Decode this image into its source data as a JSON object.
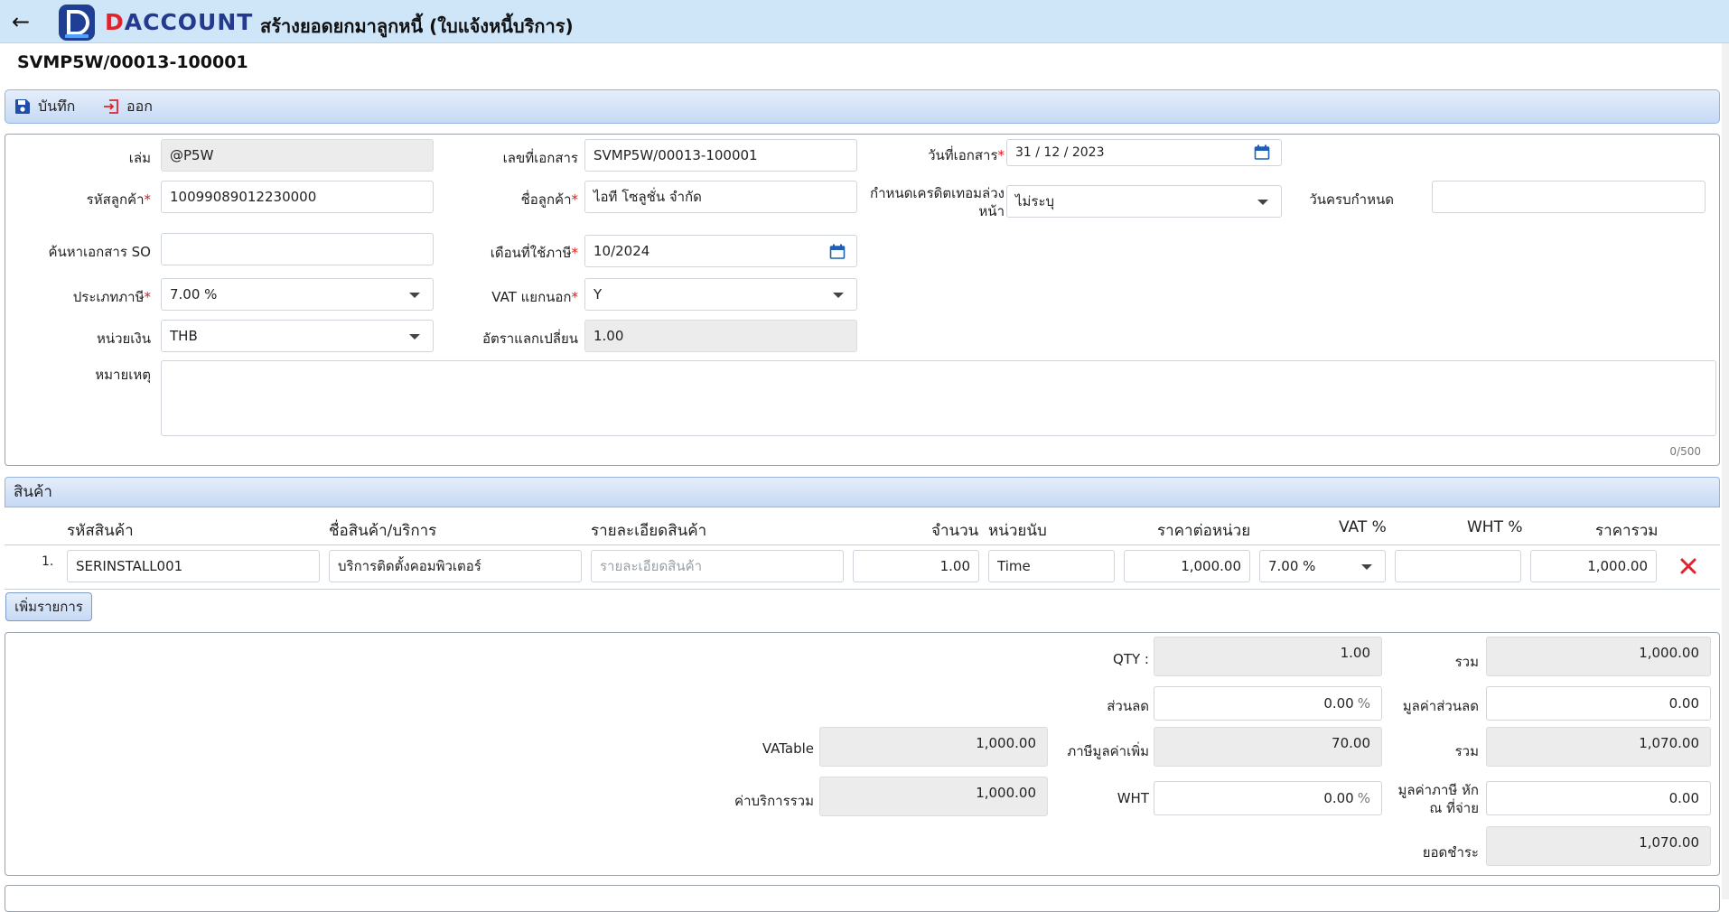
{
  "header": {
    "brand": "DACCOUNT",
    "brand_first": "D",
    "brand_rest": "ACCOUNT",
    "title": "สร้างยอดยกมาลูกหนี้ (ใบแจ้งหนี้บริการ)",
    "doc_number": "SVMP5W/00013-100001"
  },
  "toolbar": {
    "save_label": "บันทึก",
    "exit_label": "ออก"
  },
  "form": {
    "book_label": "เล่ม",
    "book_value": "@P5W",
    "docno_label": "เลขที่เอกสาร",
    "docno_value": "SVMP5W/00013-100001",
    "docdate_label": "วันที่เอกสาร",
    "docdate_value": "31 / 12 /  2023",
    "custcode_label": "รหัสลูกค้า",
    "custcode_value": "10099089012230000",
    "custname_label": "ชื่อลูกค้า",
    "custname_value": "ไอที โซลูชั่น จำกัด",
    "credit_label_1": "กำหนดเครดิตเทอมล่วง",
    "credit_label_2": "หน้า",
    "credit_value": "ไม่ระบุ",
    "duedate_label": "วันครบกำหนด",
    "duedate_value": "",
    "so_label": "ค้นหาเอกสาร SO",
    "so_value": "",
    "taxmonth_label": "เดือนที่ใช้ภาษี",
    "taxmonth_value": "10/2024",
    "taxtype_label": "ประเภทภาษี",
    "taxtype_value": "7.00 %",
    "vatsep_label": "VAT แยกนอก",
    "vatsep_value": "Y",
    "currency_label": "หน่วยเงิน",
    "currency_value": "THB",
    "rate_label": "อัตราแลกเปลี่ยน",
    "rate_value": "1.00",
    "remark_label": "หมายเหตุ",
    "remark_value": "",
    "remark_counter": "0/500",
    "required_mark": "*"
  },
  "products": {
    "section_title": "สินค้า",
    "columns": [
      "รหัสสินค้า",
      "ชื่อสินค้า/บริการ",
      "รายละเอียดสินค้า",
      "จำนวน",
      "หน่วยนับ",
      "ราคาต่อหน่วย",
      "VAT %",
      "WHT %",
      "ราคารวม"
    ],
    "rows": [
      {
        "no": "1.",
        "code": "SERINSTALL001",
        "name": "บริการติดตั้งคอมพิวเตอร์",
        "detail_placeholder": "รายละเอียดสินค้า",
        "qty": "1.00",
        "unit": "Time",
        "price": "1,000.00",
        "vat": "7.00 %",
        "wht": "",
        "total": "1,000.00"
      }
    ],
    "add_label": "เพิ่มรายการ"
  },
  "summary": {
    "qty_label": "QTY :",
    "qty_value": "1.00",
    "sum_label": "รวม",
    "sum_value": "1,000.00",
    "discount_label": "ส่วนลด",
    "discount_value": "0.00",
    "percent": "%",
    "discount_amt_label": "มูลค่าส่วนลด",
    "discount_amt_value": "0.00",
    "vatable_label": "VATable",
    "vatable_value": "1,000.00",
    "vat_label": "ภาษีมูลค่าเพิ่ม",
    "vat_value": "70.00",
    "total_label": "รวม",
    "total_value": "1,070.00",
    "service_label": "ค่าบริการรวม",
    "service_value": "1,000.00",
    "wht_label": "WHT",
    "wht_value": "0.00",
    "wht_amt_label_1": "มูลค่าภาษี หัก",
    "wht_amt_label_2": "ณ ที่จ่าย",
    "wht_amt_value": "0.00",
    "pay_label": "ยอดชำระ",
    "pay_value": "1,070.00"
  },
  "colors": {
    "topbar": "#cfe5f8",
    "accent": "#243a8c",
    "brand_red": "#e0242c",
    "required": "#d81b1b"
  },
  "icons": [
    "back-arrow-icon",
    "save-icon",
    "exit-icon",
    "calendar-icon",
    "chevron-down-icon",
    "delete-x-icon"
  ]
}
